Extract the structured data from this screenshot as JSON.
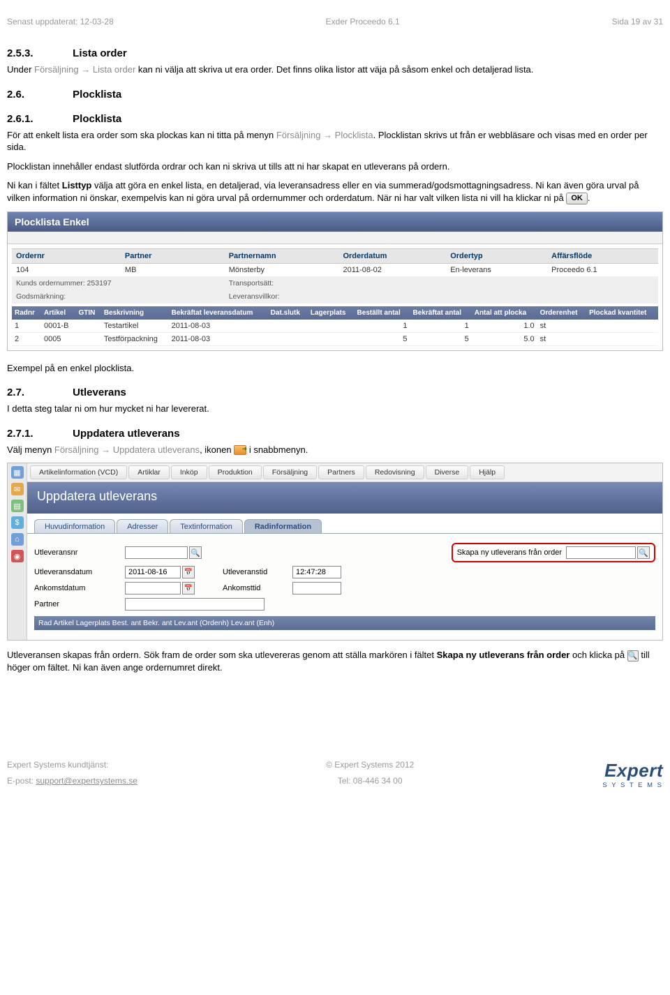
{
  "header": {
    "left": "Senast uppdaterat: 12-03-28",
    "center": "Exder Proceedo 6.1",
    "right": "Sida 19 av 31"
  },
  "s253": {
    "num": "2.5.3.",
    "title": "Lista order",
    "para_pre": "Under ",
    "para_link": "Försäljning",
    "para_arrow": " → ",
    "para_link2": "Lista order",
    "para_post": " kan ni välja att skriva ut era order. Det finns olika listor att väja på såsom enkel och detaljerad lista."
  },
  "s26": {
    "num": "2.6.",
    "title": "Plocklista"
  },
  "s261": {
    "num": "2.6.1.",
    "title": "Plocklista",
    "p1_pre": "För att enkelt lista era order som ska plockas kan ni titta på menyn ",
    "p1_link": "Försäljning",
    "p1_arrow": " → ",
    "p1_link2": "Plocklista",
    "p1_post": ". Plocklistan skrivs ut från er webbläsare och visas med en order per sida.",
    "p2": "Plocklistan innehåller endast slutförda ordrar och kan ni skriva ut tills att ni har skapat en utleverans på ordern.",
    "p3_a": "Ni kan i fältet ",
    "p3_bold": "Listtyp",
    "p3_b": " välja att göra en enkel lista, en detaljerad, via leveransadress eller en via summerad/godsmottagningsadress. Ni kan även göra urval på vilken information ni önskar, exempelvis kan ni göra urval på ordernummer och orderdatum. När ni har valt vilken lista ni vill ha klickar ni på ",
    "p3_ok": "OK",
    "p3_c": "."
  },
  "shot1": {
    "title": "Plocklista Enkel",
    "headers1": [
      "Ordernr",
      "Partner",
      "Partnernamn",
      "Orderdatum",
      "Ordertyp",
      "Affärsflöde"
    ],
    "row1": [
      "104",
      "MB",
      "Mönsterby",
      "2011-08-02",
      "En-leverans",
      "Proceedo 6.1"
    ],
    "sub_a_l": "Kunds ordernummer: 253197",
    "sub_a_r": "Transportsätt:",
    "sub_b_l": "Godsmärkning:",
    "sub_b_r": "Leveransvillkor:",
    "headers2": [
      "Radnr",
      "Artikel",
      "GTIN",
      "Beskrivning",
      "Bekräftat leveransdatum",
      "Dat.slutk",
      "Lagerplats",
      "Beställt antal",
      "Bekräftat antal",
      "Antal att plocka",
      "Orderenhet",
      "Plockad kvantitet"
    ],
    "rows2": [
      [
        "1",
        "0001-B",
        "",
        "Testartikel",
        "2011-08-03",
        "",
        "",
        "1",
        "1",
        "1.0",
        "st",
        ""
      ],
      [
        "2",
        "0005",
        "",
        "Testförpackning",
        "2011-08-03",
        "",
        "",
        "5",
        "5",
        "5.0",
        "st",
        ""
      ]
    ]
  },
  "post_shot1": "Exempel på en enkel plocklista.",
  "s27": {
    "num": "2.7.",
    "title": "Utleverans",
    "p": "I detta steg talar ni om hur mycket ni har levererat."
  },
  "s271": {
    "num": "2.7.1.",
    "title": "Uppdatera utleverans",
    "p_pre": "Välj menyn ",
    "p_link": "Försäljning",
    "p_arrow": " → ",
    "p_link2": "Uppdatera utleverans",
    "p_mid": ", ikonen ",
    "p_post": " i snabbmenyn."
  },
  "shot2": {
    "menu": [
      "Artikelinformation (VCD)",
      "Artiklar",
      "Inköp",
      "Produktion",
      "Försäljning",
      "Partners",
      "Redovisning",
      "Diverse",
      "Hjälp"
    ],
    "formtitle": "Uppdatera utleverans",
    "tabs": [
      "Huvudinformation",
      "Adresser",
      "Textinformation",
      "Radinformation"
    ],
    "fields": {
      "utleveransnr": "Utleveransnr",
      "skapa": "Skapa ny utleverans från order",
      "utlevdatum_l": "Utleveransdatum",
      "utlevdatum_v": "2011-08-16",
      "utlevtid_l": "Utleveranstid",
      "utlevtid_v": "12:47:28",
      "ankdatum": "Ankomstdatum",
      "anktid": "Ankomsttid",
      "partner": "Partner"
    },
    "colhdr": "Rad  Artikel  Lagerplats  Best. ant  Bekr. ant  Lev.ant (Ordenh)  Lev.ant (Enh)"
  },
  "p_after": {
    "a": "Utleveransen skapas från ordern. Sök fram de order som ska utlevereras genom att ställa markören i fältet ",
    "bold": "Skapa ny utleverans från order",
    "b": " och klicka på ",
    "c": " till höger om fältet. Ni kan även ange ordernumret direkt."
  },
  "footer": {
    "l1": "Expert Systems kundtjänst:",
    "l2_pre": "E-post: ",
    "l2_link": "support@expertsystems.se",
    "c1": "© Expert Systems 2012",
    "c2": "Tel: 08-446 34 00",
    "brand": "Expert",
    "tag": "S Y S T E M S"
  }
}
